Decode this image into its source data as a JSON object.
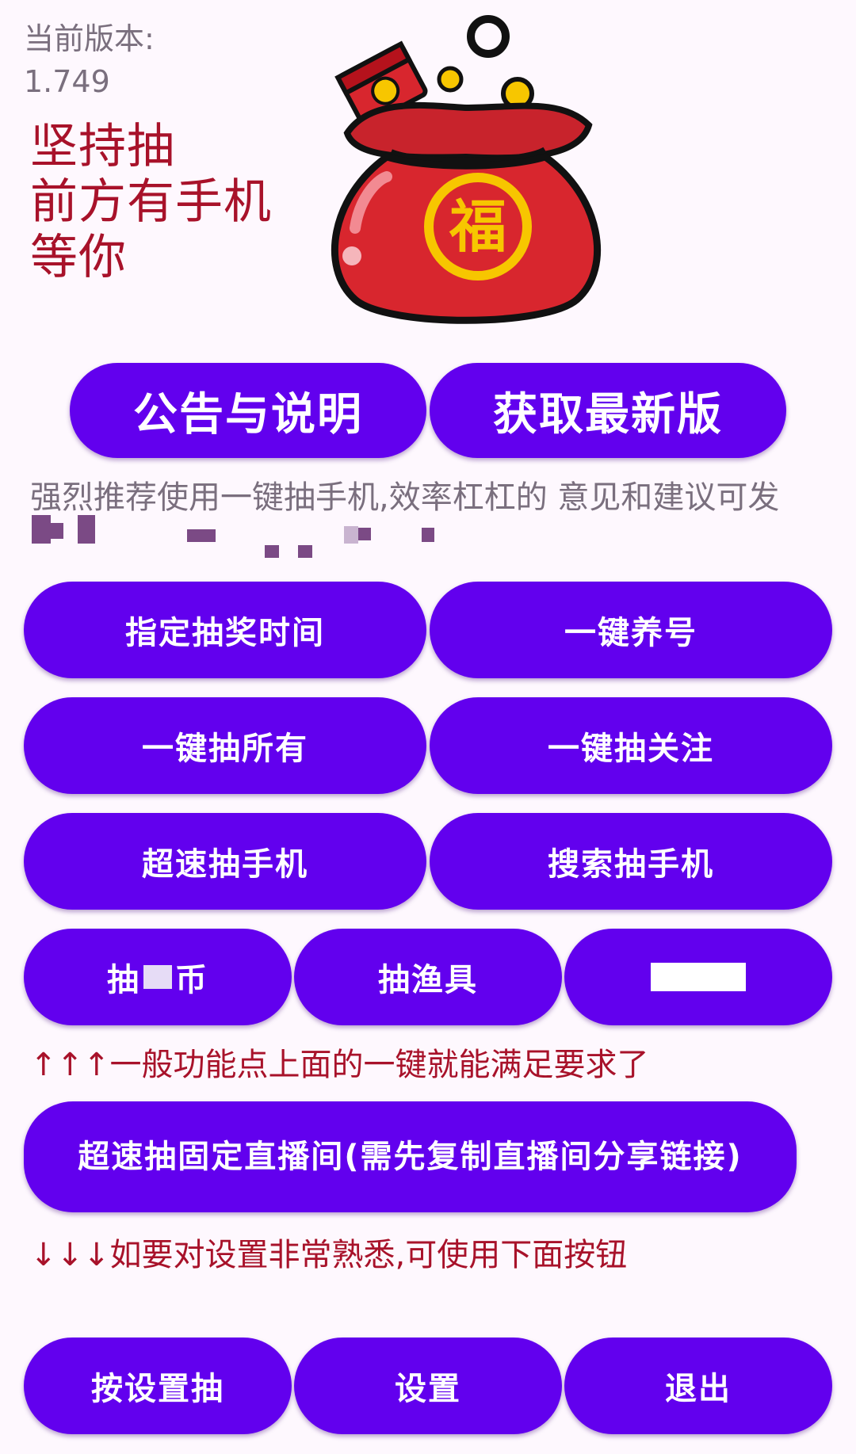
{
  "header": {
    "version_label": "当前版本:\n1.749",
    "slogan": "坚持抽\n前方有手机\n等你"
  },
  "image": {
    "icon": "fortune-bag-icon",
    "character": "福"
  },
  "top_buttons": {
    "announcement": "公告与说明",
    "get_latest": "获取最新版"
  },
  "recommend_text": "强烈推荐使用一键抽手机,效率杠杠的 意见和建议可发",
  "buttons": {
    "schedule_time": "指定抽奖时间",
    "nurture_account": "一键养号",
    "draw_all": "一键抽所有",
    "draw_followed": "一键抽关注",
    "super_fast_phone": "超速抽手机",
    "search_phone": "搜索抽手机",
    "coin_prefix": "抽",
    "coin_suffix": "币",
    "fishing_gear": "抽渔具",
    "fixed_live_room": "超速抽固定直播间(需先复制直播间分享链接)",
    "draw_by_settings": "按设置抽",
    "settings": "设置",
    "exit": "退出"
  },
  "hints": {
    "up": "↑↑↑一般功能点上面的一键就能满足要求了",
    "down": "↓↓↓如要对设置非常熟悉,可使用下面按钮"
  },
  "colors": {
    "button": "#6200EE",
    "accent_text": "#A8122A",
    "muted_text": "#7A6F7E",
    "background": "#FEF8FE"
  }
}
